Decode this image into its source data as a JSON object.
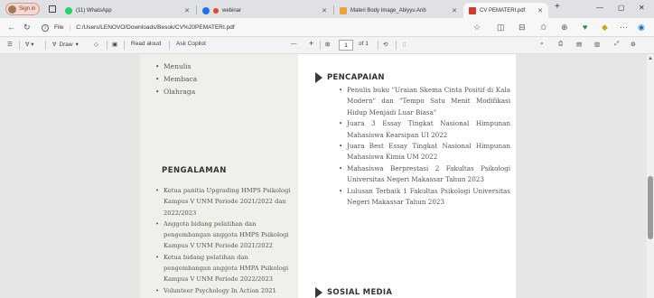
{
  "browser": {
    "profile_label": "Sign in",
    "tabs": [
      {
        "title": "(11) WhatsApp",
        "favicon_color": "#25d366"
      },
      {
        "title": "webinar",
        "favicon_color": "#1a73e8"
      },
      {
        "title": "Materi Body Image_Abiyyu Anb",
        "favicon_color": "#e8a33a"
      },
      {
        "title": "CV PEMATERI.pdf",
        "favicon_color": "#d33b2f"
      }
    ],
    "new_tab": "+",
    "url_prefix": "File",
    "url": "C:/Users/LENOVO/Downloads/Besok/CV%20PEMATERI.pdf"
  },
  "pdf_toolbar": {
    "draw_label": "Draw",
    "read_aloud_label": "Read aloud",
    "ask_copilot_label": "Ask Copilot",
    "zoom_out": "—",
    "zoom_in": "+",
    "page_current": "1",
    "page_total": "of 1"
  },
  "cv": {
    "hobbies": [
      "Menulis",
      "Membaca",
      "Olahraga"
    ],
    "experience_heading": "PENGALAMAN",
    "experience": [
      "Ketua panitia Upgrading HMPS Psikologi Kampus V UNM Periode 2021/2022 dan 2022/2023",
      "Anggota bidang pelatihan dan pengembangan anggota HMPS Psikologi Kampus V UNM Periode 2021/2022",
      "Ketua bidang pelatihan dan pengembangan anggota HMPA Psikologi Kampus V UNM Periode 2022/2023",
      "Volunteer Psychology In Action 2021"
    ],
    "achievements_heading": "PENCAPAIAN",
    "achievements": [
      "Penulis buku \"Uraian Skema Cinta Positif di Kala Modern\" dan \"Tempo Satu Menit Modifikasi Hidup Menjadi Luar Biasa\"",
      "Juara 3 Essay Tingkat Nasional Himpunan Mahasiswa Kearsipan UI 2022",
      "Juara Best Essay Tingkat Nasional Himpunan Mahasiswa Kimia UM 2022",
      "Mahasiswa Berprestasi 2 Fakultas Psikologi Universitas Negeri Makassar Tahun 2023",
      "Lulusan Terbaik 1 Fakultas Psikologi Universitas Negeri Makassar Tahun 2023"
    ],
    "social_heading": "SOSIAL MEDIA"
  }
}
